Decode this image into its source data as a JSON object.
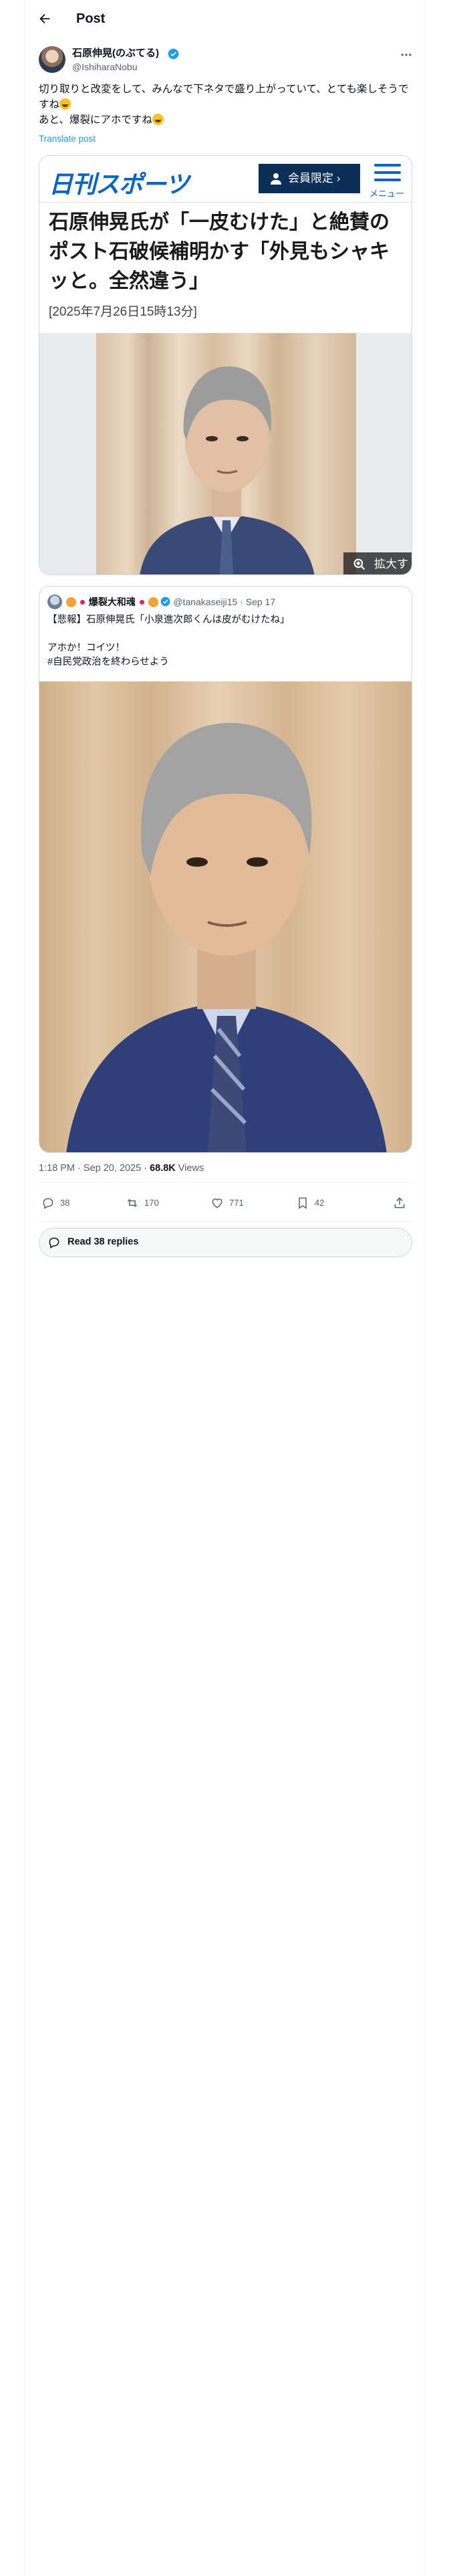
{
  "header": {
    "title": "Post"
  },
  "author": {
    "name": "石原伸晃(のぶてる)",
    "handle": "@IshiharaNobu"
  },
  "tweet": {
    "text": "切り取りと改変をして、みんなで下ネタで盛り上がっていて、とても楽しそうですね",
    "text2": "あと、爆裂にアホですね",
    "translate_label": "Translate post"
  },
  "article_card": {
    "logo": "日刊スポーツ",
    "member_label": "会員限定",
    "menu_label": "メニュー",
    "title": "石原伸晃氏が「一皮むけた」と絶賛のポスト石破候補明かす「外見もシャキッと。全然違う」",
    "date": "[2025年7月26日15時13分]",
    "zoom_label": "拡大する"
  },
  "quote": {
    "name": "爆裂大和魂",
    "handle": "@tanakaseiji15",
    "date": "Sep 17",
    "line1": "【悲報】石原伸晃氏「小泉進次郎くんは皮がむけたね」",
    "line2": "アホか！コイツ！",
    "line3": "#自民党政治を終わらせよう"
  },
  "meta": {
    "time": "1:18 PM · Sep 20, 2025 · ",
    "views": "68.8K",
    "views_label": " Views"
  },
  "actions": {
    "replies": "38",
    "reposts": "170",
    "likes": "771",
    "bookmarks": "42"
  },
  "read_replies_label": "Read 38 replies",
  "colors": {
    "accent": "#1d9bf0",
    "nikkan_blue": "#0a64c8",
    "member_navy": "#0b2f57"
  }
}
